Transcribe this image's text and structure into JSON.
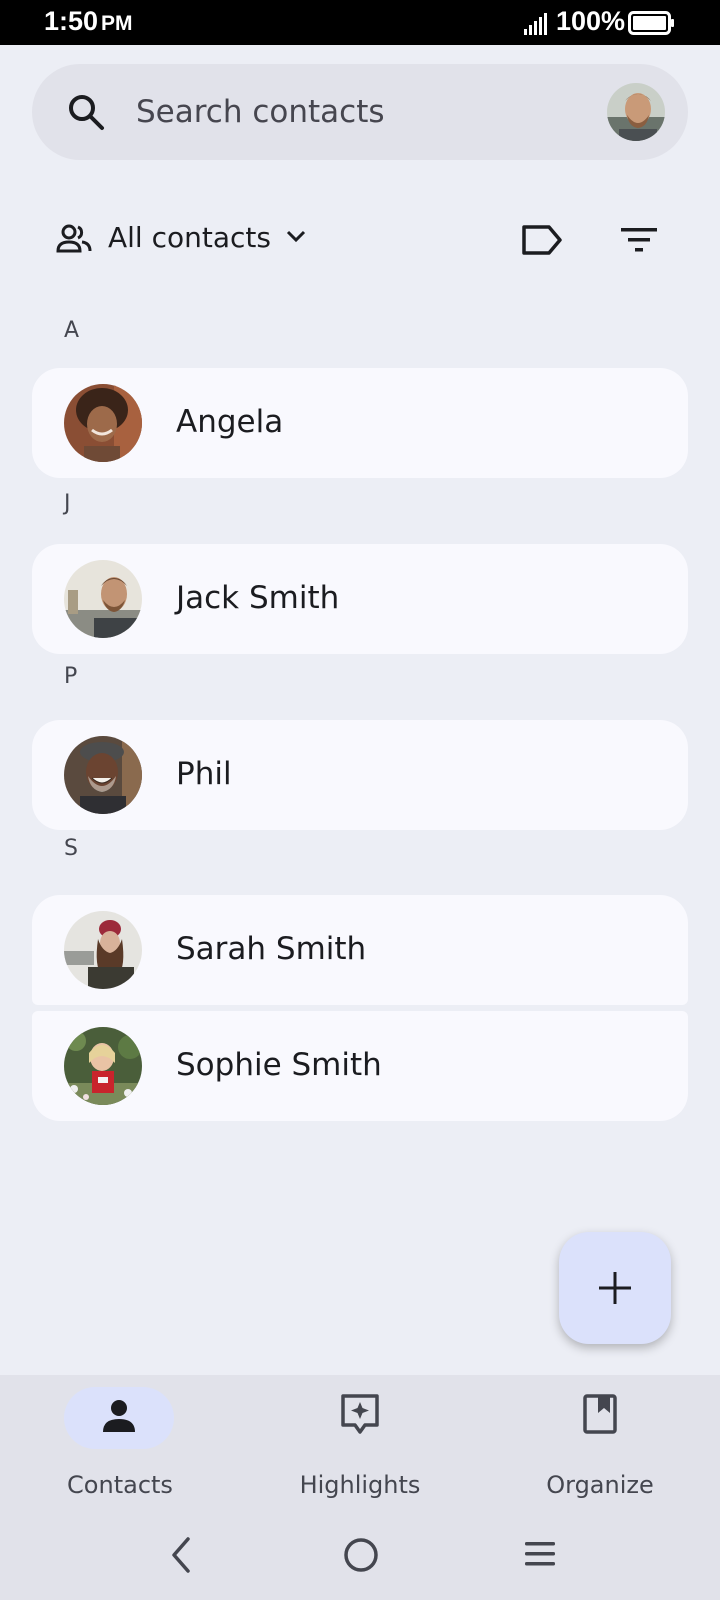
{
  "status": {
    "time": "1:50",
    "ampm": "PM",
    "battery": "100%"
  },
  "search": {
    "placeholder": "Search contacts"
  },
  "filter": {
    "label": "All contacts"
  },
  "sections": [
    {
      "letter": "A",
      "contacts": [
        {
          "name": "Angela"
        }
      ]
    },
    {
      "letter": "J",
      "contacts": [
        {
          "name": "Jack Smith"
        }
      ]
    },
    {
      "letter": "P",
      "contacts": [
        {
          "name": "Phil"
        }
      ]
    },
    {
      "letter": "S",
      "contacts": [
        {
          "name": "Sarah Smith"
        },
        {
          "name": "Sophie Smith"
        }
      ]
    }
  ],
  "bottom_nav": {
    "items": [
      {
        "label": "Contacts",
        "icon": "person-icon",
        "selected": true
      },
      {
        "label": "Highlights",
        "icon": "highlights-icon",
        "selected": false
      },
      {
        "label": "Organize",
        "icon": "bookmark-icon",
        "selected": false
      }
    ]
  },
  "colors": {
    "background": "#eceef5",
    "card": "#f9f9fe",
    "accent_container": "#dbe1fb",
    "nav_bar": "#e1e2ea"
  }
}
